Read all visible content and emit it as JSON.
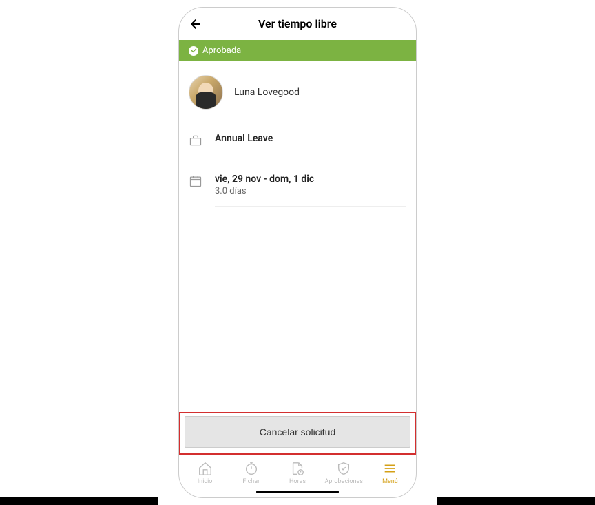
{
  "header": {
    "title": "Ver tiempo libre"
  },
  "status": {
    "label": "Aprobada"
  },
  "user": {
    "name": "Luna Lovegood"
  },
  "leave": {
    "type": "Annual Leave",
    "dates": "vie, 29 nov - dom, 1 dic",
    "duration": "3.0 días"
  },
  "actions": {
    "cancel": "Cancelar solicitud"
  },
  "nav": {
    "home": "Inicio",
    "clock": "Fichar",
    "hours": "Horas",
    "approvals": "Aprobaciones",
    "menu": "Menú"
  }
}
